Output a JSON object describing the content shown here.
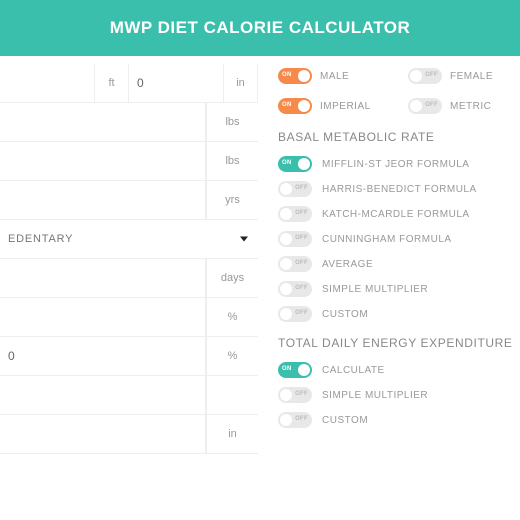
{
  "header": {
    "title": "MWP DIET CALORIE CALCULATOR"
  },
  "left": {
    "height_ft": {
      "value": "",
      "unit": "ft"
    },
    "height_in": {
      "value": "0",
      "unit": "in"
    },
    "weight": {
      "value": "",
      "unit": "lbs"
    },
    "weight2": {
      "value": "",
      "unit": "lbs"
    },
    "age": {
      "value": "",
      "unit": "yrs"
    },
    "activity": {
      "value": "EDENTARY"
    },
    "days": {
      "value": "",
      "unit": "days"
    },
    "pct1": {
      "value": "",
      "unit": "%"
    },
    "pct2": {
      "value": "0",
      "unit": "%"
    },
    "blank1": {
      "value": "",
      "unit": ""
    },
    "last": {
      "value": "",
      "unit": "in"
    }
  },
  "right": {
    "gender": {
      "on_label": "MALE",
      "off_label": "FEMALE"
    },
    "units": {
      "on_label": "IMPERIAL",
      "off_label": "METRIC"
    },
    "bmr": {
      "heading": "BASAL METABOLIC RATE",
      "options": [
        {
          "label": "MIFFLIN-ST JEOR FORMULA",
          "active": true
        },
        {
          "label": "HARRIS-BENEDICT FORMULA",
          "active": false
        },
        {
          "label": "KATCH-MCARDLE FORMULA",
          "active": false
        },
        {
          "label": "CUNNINGHAM FORMULA",
          "active": false
        },
        {
          "label": "AVERAGE",
          "active": false
        },
        {
          "label": "SIMPLE MULTIPLIER",
          "active": false
        },
        {
          "label": "CUSTOM",
          "active": false
        }
      ]
    },
    "tdee": {
      "heading": "TOTAL DAILY ENERGY EXPENDITURE",
      "options": [
        {
          "label": "CALCULATE",
          "active": true
        },
        {
          "label": "SIMPLE MULTIPLIER",
          "active": false
        },
        {
          "label": "CUSTOM",
          "active": false
        }
      ]
    }
  },
  "toggle_text": {
    "on": "ON",
    "off": "OFF"
  }
}
